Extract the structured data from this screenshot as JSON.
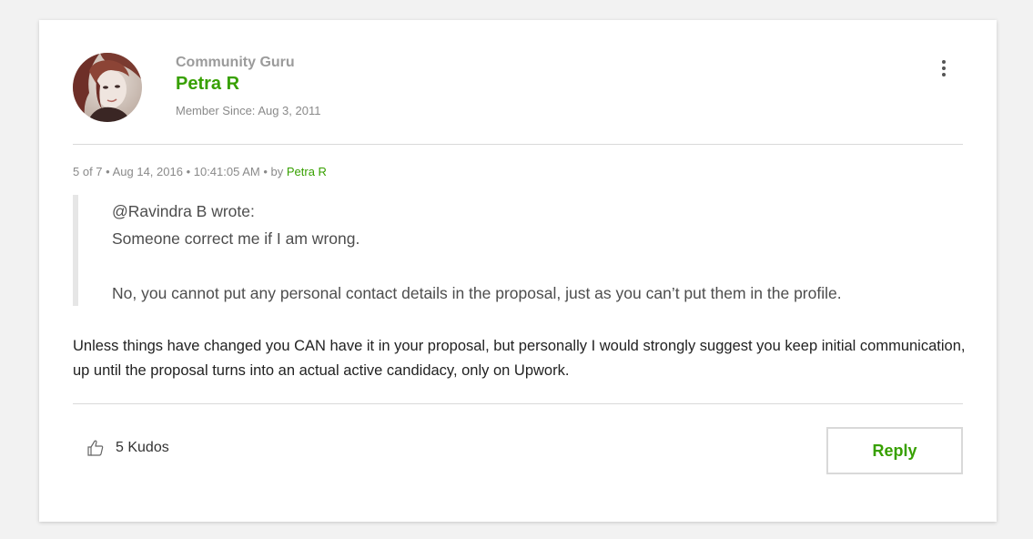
{
  "post": {
    "author": {
      "rank": "Community Guru",
      "name": "Petra R",
      "member_since": "Member Since: Aug 3, 2011"
    },
    "meta": {
      "position": "5 of 7",
      "separator": " • ",
      "date": "Aug 14, 2016",
      "time": "10:41:05 AM",
      "by_prefix": "by ",
      "by_author": "Petra R"
    },
    "quote": {
      "header": "@Ravindra B wrote:",
      "line1": "Someone correct me if I am wrong.",
      "line2": "No, you cannot put any personal contact details in the proposal, just as you can’t put them in the profile."
    },
    "body": " Unless things have changed you CAN have it in your proposal, but personally I would strongly suggest you keep initial communication, up until the proposal turns into an actual active candidacy, only on Upwork.",
    "kudos": {
      "count": "5",
      "label": "5 Kudos",
      "icon": "thumbs-up-icon"
    },
    "reply_label": "Reply",
    "options_icon": "kebab-menu-icon"
  },
  "colors": {
    "accent": "#37a000",
    "muted_text": "#8a8a8a",
    "divider": "#d9d9d9",
    "page_background": "#f2f2f2"
  }
}
